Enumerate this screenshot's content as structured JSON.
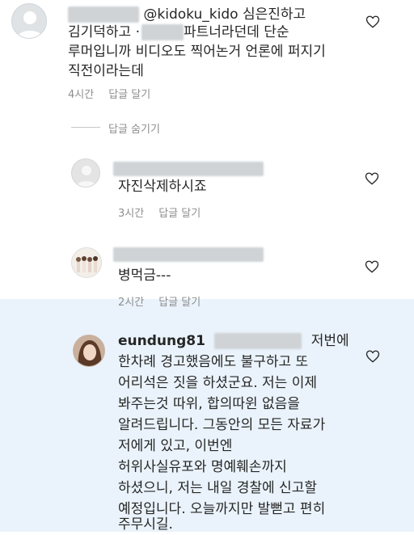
{
  "comments": [
    {
      "username": "@kidoku_kido",
      "lines": [
        "심은진하고",
        "김기덕하고 ·",
        "파트너라던데 단순",
        "루머입니까 비디오도 찍어논거 언론에 퍼지기",
        "직전이라는데"
      ],
      "time": "4시간",
      "reply_label": "답글 달기"
    },
    {
      "hide_replies_label": "답글 숨기기"
    },
    {
      "lines": [
        "자진삭제하시죠"
      ],
      "time": "3시간",
      "reply_label": "답글 달기"
    },
    {
      "lines": [
        "병먹금---"
      ],
      "time": "2시간",
      "reply_label": "답글 달기"
    },
    {
      "username": "eundung81",
      "lines": [
        "저번에",
        "한차례 경고했음에도 불구하고 또",
        "어리석은 짓을 하셨군요. 저는 이제",
        "봐주는것 따위, 합의따윈 없음을",
        "알려드립니다. 그동안의 모든 자료가",
        "저에게 있고, 이번엔",
        "허위사실유포와 명예훼손까지",
        "하셨으니, 저는 내일 경찰에 신고할",
        "예정입니다. 오늘까지만 발뻗고 편히",
        "주무시길."
      ]
    }
  ],
  "icons": {
    "like": "heart-outline-icon",
    "avatar": "profile-photo"
  },
  "colors": {
    "highlight": "#eaf3fb",
    "meta": "#8e8e8e",
    "text": "#262626"
  }
}
